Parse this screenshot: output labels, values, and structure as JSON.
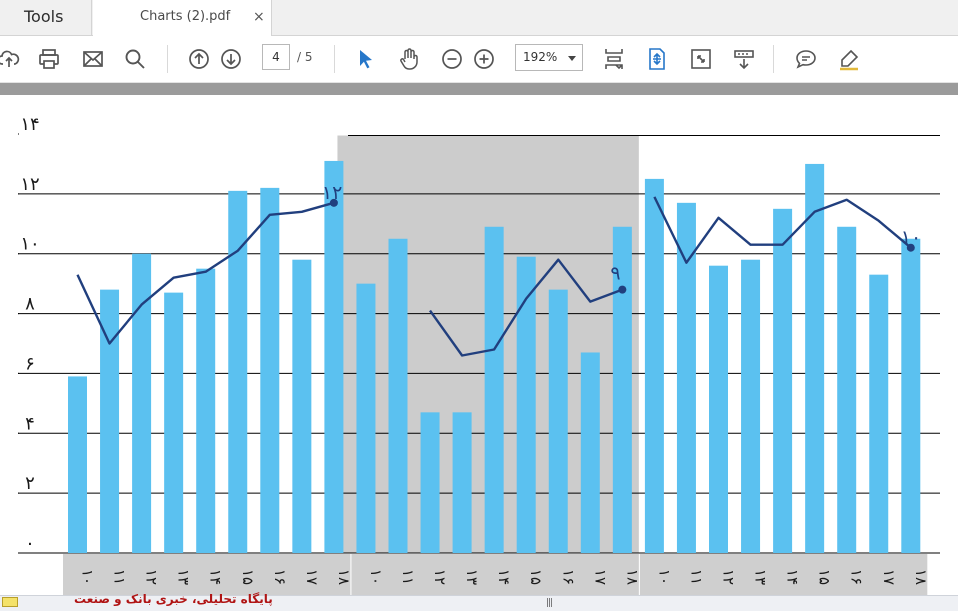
{
  "tabs": {
    "tools_label": "Tools",
    "document_title": "Charts (2).pdf",
    "close_glyph": "×"
  },
  "toolbar": {
    "icons": [
      "upload-icon",
      "print-icon",
      "email-icon",
      "search-icon",
      "page-up-icon",
      "page-down-icon",
      "select-cursor-icon",
      "hand-tool-icon",
      "zoom-out-icon",
      "zoom-in-icon",
      "fit-page-icon",
      "scroll-mode-icon",
      "full-screen-icon",
      "read-mode-icon",
      "comment-icon",
      "highlight-pen-icon"
    ],
    "current_page": "4",
    "page_total": "/ 5",
    "zoom": "192%"
  },
  "chart_data": {
    "type": "bar",
    "ylim": [
      0,
      14
    ],
    "y_ticks": [
      "۰",
      "۲",
      "۴",
      "۶",
      "۸",
      "۱۰",
      "۱۲",
      "۱۴"
    ],
    "categories": [
      "۱۰",
      "۱۱",
      "۱۲",
      "۱۳",
      "۱۴",
      "۱۵",
      "۱۶",
      "۱۷",
      "۱۸",
      "۱۰",
      "۱۱",
      "۱۲",
      "۱۳",
      "۱۴",
      "۱۵",
      "۱۶",
      "۱۷",
      "۱۸",
      "۱۰",
      "۱۱",
      "۱۲",
      "۱۳",
      "۱۴",
      "۱۵",
      "۱۶",
      "۱۷",
      "۱۸"
    ],
    "groups": [
      {
        "bars": [
          5.9,
          8.8,
          10.0,
          8.7,
          9.5,
          12.1,
          12.2,
          9.8,
          13.1
        ],
        "line": [
          9.3,
          7.0,
          8.3,
          9.2,
          9.4,
          10.1,
          11.3,
          11.4,
          11.7
        ],
        "end_label": "۱۲"
      },
      {
        "bars": [
          9.0,
          10.5,
          4.7,
          4.7,
          10.9,
          9.9,
          8.8,
          6.7,
          10.9
        ],
        "line": [
          8.1,
          6.6,
          6.8,
          8.5,
          9.8,
          8.4,
          8.8
        ],
        "end_label": "۹"
      },
      {
        "bars": [
          12.5,
          11.7,
          9.6,
          9.8,
          11.5,
          13.0,
          10.9,
          9.3,
          10.5
        ],
        "line": [
          11.9,
          9.7,
          11.2,
          10.3,
          10.3,
          11.4,
          11.8,
          11.1,
          10.2
        ],
        "end_label": "۱۰"
      }
    ],
    "highlighted_group": 1,
    "colors": {
      "bar": "#5bc1f0",
      "line": "#213f7e",
      "highlight": "#cccccc",
      "grid": "#000000"
    }
  },
  "footer": {
    "watermark_text": "پایگاه تحلیلی، خبری بانک و صنعت",
    "scroll_grip": "|||"
  }
}
